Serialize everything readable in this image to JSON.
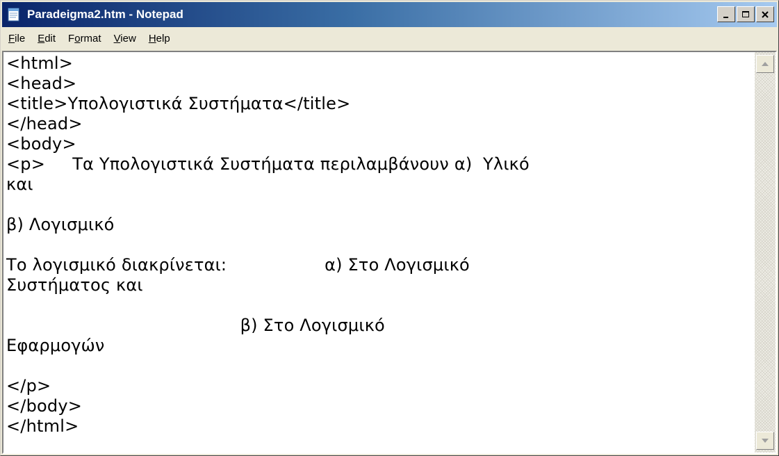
{
  "window": {
    "title": "Paradeigma2.htm - Notepad",
    "accent": "#0a246a"
  },
  "icons": {
    "app": "notepad-icon",
    "minimize": "minimize-icon",
    "maximize": "maximize-icon",
    "close": "close-icon",
    "scroll_up": "scroll-up-arrow-icon",
    "scroll_down": "scroll-down-arrow-icon"
  },
  "menu": {
    "items": [
      {
        "label": "File",
        "mnemonic": "F"
      },
      {
        "label": "Edit",
        "mnemonic": "E"
      },
      {
        "label": "Format",
        "mnemonic": "o"
      },
      {
        "label": "View",
        "mnemonic": "V"
      },
      {
        "label": "Help",
        "mnemonic": "H"
      }
    ]
  },
  "editor": {
    "lines": [
      "<html>",
      "<head>",
      "<title>Υπολογιστικά Συστήματα</title>",
      "</head>",
      "<body>",
      "<p>     Τα Υπολογιστικά Συστήματα περιλαμβάνουν α)  Υλικό",
      "και",
      "",
      "β) Λογισμικό",
      "",
      "Το λογισμικό διακρίνεται:                  α) Στο Λογισμικό",
      "Συστήματος και",
      "",
      "                                           β) Στο Λογισμικό",
      "Εφαρμογών",
      "",
      "</p>",
      "</body>",
      "</html>"
    ]
  }
}
